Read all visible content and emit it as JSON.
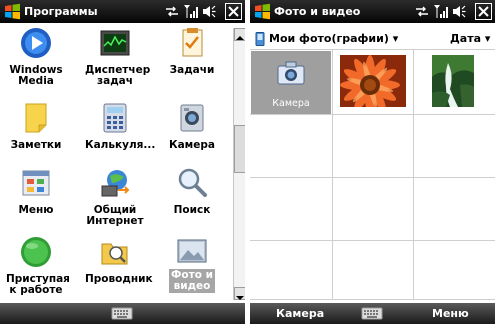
{
  "left_screen": {
    "title": "Программы",
    "programs": [
      {
        "label_line1": "Windows",
        "label_line2": "Media",
        "icon": "windows-media-icon"
      },
      {
        "label_line1": "Диспетчер",
        "label_line2": "задач",
        "icon": "task-manager-icon"
      },
      {
        "label_line1": "Задачи",
        "label_line2": "",
        "icon": "tasks-icon"
      },
      {
        "label_line1": "Заметки",
        "label_line2": "",
        "icon": "notes-icon"
      },
      {
        "label_line1": "Калькуля...",
        "label_line2": "",
        "icon": "calculator-icon"
      },
      {
        "label_line1": "Камера",
        "label_line2": "",
        "icon": "camera-icon"
      },
      {
        "label_line1": "Меню",
        "label_line2": "",
        "icon": "menu-icon"
      },
      {
        "label_line1": "Общий",
        "label_line2": "Интернет",
        "icon": "internet-sharing-icon"
      },
      {
        "label_line1": "Поиск",
        "label_line2": "",
        "icon": "search-icon"
      },
      {
        "label_line1": "Приступая",
        "label_line2": "к работе",
        "icon": "getting-started-icon"
      },
      {
        "label_line1": "Проводник",
        "label_line2": "",
        "icon": "file-explorer-icon"
      },
      {
        "label_line1": "Фото и",
        "label_line2": "видео",
        "icon": "photos-videos-icon",
        "selected": true
      }
    ]
  },
  "right_screen": {
    "title": "Фото и видео",
    "folder_label": "Мои фото(графии) ▾",
    "sort_label": "Дата ▾",
    "camera_tile_label": "Камера",
    "soft_key_left": "Камера",
    "soft_key_right": "Меню"
  },
  "colors": {
    "titlebar": "#111111",
    "menubar": "#3a3a3a",
    "selection": "#a6a6a6",
    "grid_line": "#cfcfcf"
  }
}
